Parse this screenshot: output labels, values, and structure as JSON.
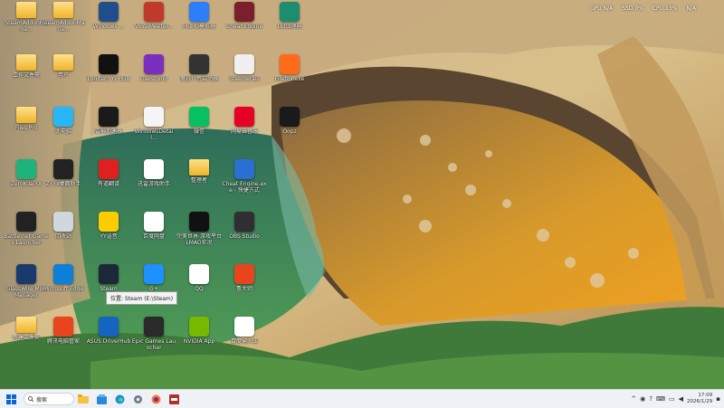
{
  "desktop": {
    "icons": [
      {
        "label": "SteamAddonMana...",
        "icon": "folder-icon",
        "color": "#f0b429"
      },
      {
        "label": "SteamAddonMana...",
        "icon": "folder-icon",
        "color": "#f0b429"
      },
      {
        "label": "Windows ...",
        "icon": "cat-icon",
        "color": "#1f4e8c"
      },
      {
        "label": "VoiceMeeter...",
        "icon": "voicemeeter-icon",
        "color": "#c0392b"
      },
      {
        "label": "MuMu模拟器",
        "icon": "mumu-icon",
        "color": "#2d7ff9"
      },
      {
        "label": "Cheat Engine",
        "icon": "cheat-engine-icon",
        "color": "#7b1e2d"
      },
      {
        "label": "UU加速器",
        "icon": "uu-icon",
        "color": "#1e8c6e"
      },
      {
        "label": "工作文件夹",
        "icon": "folder-icon",
        "color": "#f0b429"
      },
      {
        "label": "用户",
        "icon": "user-folder-icon",
        "color": "#f0b429"
      },
      {
        "label": "Logitech G HUB",
        "icon": "logitech-icon",
        "color": "#111111"
      },
      {
        "label": "Gaysound",
        "icon": "purple-icon",
        "color": "#7a2fc0"
      },
      {
        "label": "鬼谷八荒启动器",
        "icon": "game-icon",
        "color": "#333333"
      },
      {
        "label": "SteelSeries",
        "icon": "steelseries-icon",
        "color": "#f0f0f0"
      },
      {
        "label": "Firefox.exe",
        "icon": "firefox-icon",
        "color": "#ff6b1a"
      },
      {
        "label": "Files Pro",
        "icon": "folder-icon",
        "color": "#f0b429"
      },
      {
        "label": "此电脑",
        "icon": "pc-icon",
        "color": "#29b6f6"
      },
      {
        "label": "雷神加速器",
        "icon": "arrow-icon",
        "color": "#1a1a1a"
      },
      {
        "label": "WindowsDetail...",
        "icon": "file-icon",
        "color": "#f5f5f5"
      },
      {
        "label": "微信",
        "icon": "wechat-icon",
        "color": "#07c160"
      },
      {
        "label": "网易云音乐",
        "icon": "netease-music-icon",
        "color": "#e60026"
      },
      {
        "label": "Oopz",
        "icon": "oopz-icon",
        "color": "#1a1a1a"
      },
      {
        "label": "ZeroKuaiYX",
        "icon": "lightning-icon",
        "color": "#1db37a"
      },
      {
        "label": "ZYYx桌面助手",
        "icon": "circle-icon",
        "color": "#222222"
      },
      {
        "label": "有道翻译",
        "icon": "youdao-icon",
        "color": "#e02020"
      },
      {
        "label": "迅雷游戏助手",
        "icon": "game-assistant-icon",
        "color": "#ffffff"
      },
      {
        "label": "整理者",
        "icon": "folder-icon",
        "color": "#f0b429"
      },
      {
        "label": "Cheat Engine.exe - 快捷方式",
        "icon": "shield-icon",
        "color": "#2a6fd1"
      },
      {
        "label": "Battle.net Games Launcher",
        "icon": "battlenet-icon",
        "color": "#222222"
      },
      {
        "label": "回收站",
        "icon": "recycle-bin-icon",
        "color": "#cfd8dc"
      },
      {
        "label": "YY语音",
        "icon": "yy-icon",
        "color": "#ffcc00"
      },
      {
        "label": "百度网盘",
        "icon": "baidu-icon",
        "color": "#ffffff"
      },
      {
        "label": "完美世界·游戏平台 LMAO实况",
        "icon": "dance-icon",
        "color": "#111111"
      },
      {
        "label": "OBS Studio",
        "icon": "obs-icon",
        "color": "#302e31"
      },
      {
        "label": "GlassWire Mod Manager",
        "icon": "g-icon",
        "color": "#1a3a6e"
      },
      {
        "label": "Microsoft Edge",
        "icon": "edge-icon",
        "color": "#0c80d8"
      },
      {
        "label": "Steam",
        "icon": "steam-icon",
        "color": "#1b2838"
      },
      {
        "label": "G+",
        "icon": "gplus-icon",
        "color": "#1e90ff"
      },
      {
        "label": "QQ",
        "icon": "qq-icon",
        "color": "#ffffff"
      },
      {
        "label": "鲁大师",
        "icon": "master-icon",
        "color": "#e8441e"
      },
      {
        "label": "新建文件夹",
        "icon": "folder-icon",
        "color": "#f0b429"
      },
      {
        "label": "腾讯电脑管家",
        "icon": "edge-old-icon",
        "color": "#e8441e"
      },
      {
        "label": "ASUS DriverHub",
        "icon": "asus-icon",
        "color": "#1565c0"
      },
      {
        "label": "Epic Games Launcher",
        "icon": "epic-icon",
        "color": "#2a2a2a"
      },
      {
        "label": "NVIDIA App",
        "icon": "nvidia-icon",
        "color": "#76b900"
      },
      {
        "label": "百度输入法",
        "icon": "rooster-icon",
        "color": "#ffffff"
      }
    ],
    "tooltip": "位置: Steam (E:\\Steam)"
  },
  "perf": {
    "gpu": "GPU N/A",
    "disk": "SSD 0%",
    "cpu": "CPU 13%",
    "net": "N/A"
  },
  "taskbar": {
    "search_placeholder": "搜索",
    "time": "17:09",
    "date": "2026/1/29"
  }
}
